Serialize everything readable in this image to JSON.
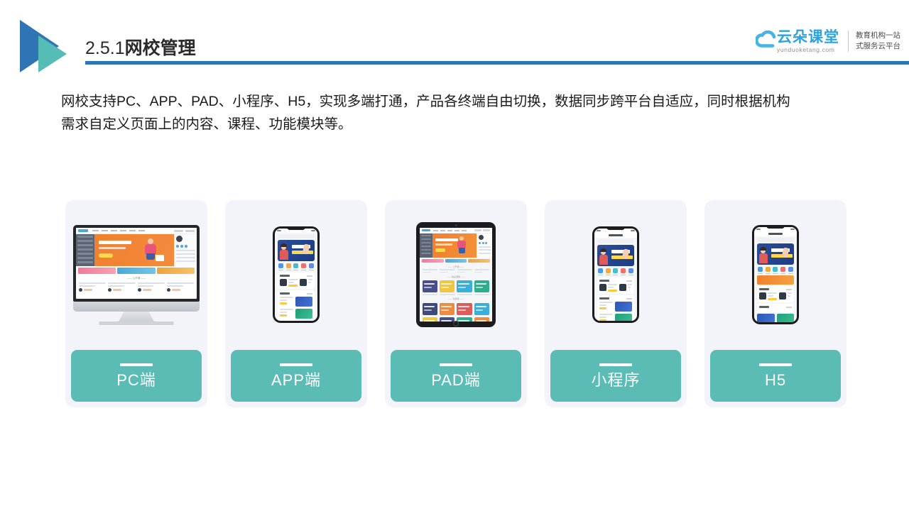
{
  "header": {
    "title_number": "2.5.1",
    "title_text": "网校管理",
    "rule_color": "#2e75b6",
    "logo_blue": "#2f74b5",
    "logo_teal": "#55bcb6"
  },
  "brand": {
    "name_cn": "云朵课堂",
    "url": "yunduoketang.com",
    "tagline_line1": "教育机构一站",
    "tagline_line2": "式服务云平台",
    "accent_color": "#2aa3e0"
  },
  "paragraph": {
    "line1": "网校支持PC、APP、PAD、小程序、H5，实现多端打通，产品各终端自由切换，数据同步跨平台自适应，同时根据机构",
    "line2": "需求自定义页面上的内容、课程、功能模块等。"
  },
  "cards": {
    "accent_color": "#5bbcb6",
    "background_color": "#f3f4fa",
    "items": [
      {
        "label": "PC端",
        "device": "desktop-monitor"
      },
      {
        "label": "APP端",
        "device": "smartphone"
      },
      {
        "label": "PAD端",
        "device": "tablet"
      },
      {
        "label": "小程序",
        "device": "smartphone"
      },
      {
        "label": "H5",
        "device": "smartphone"
      }
    ]
  }
}
